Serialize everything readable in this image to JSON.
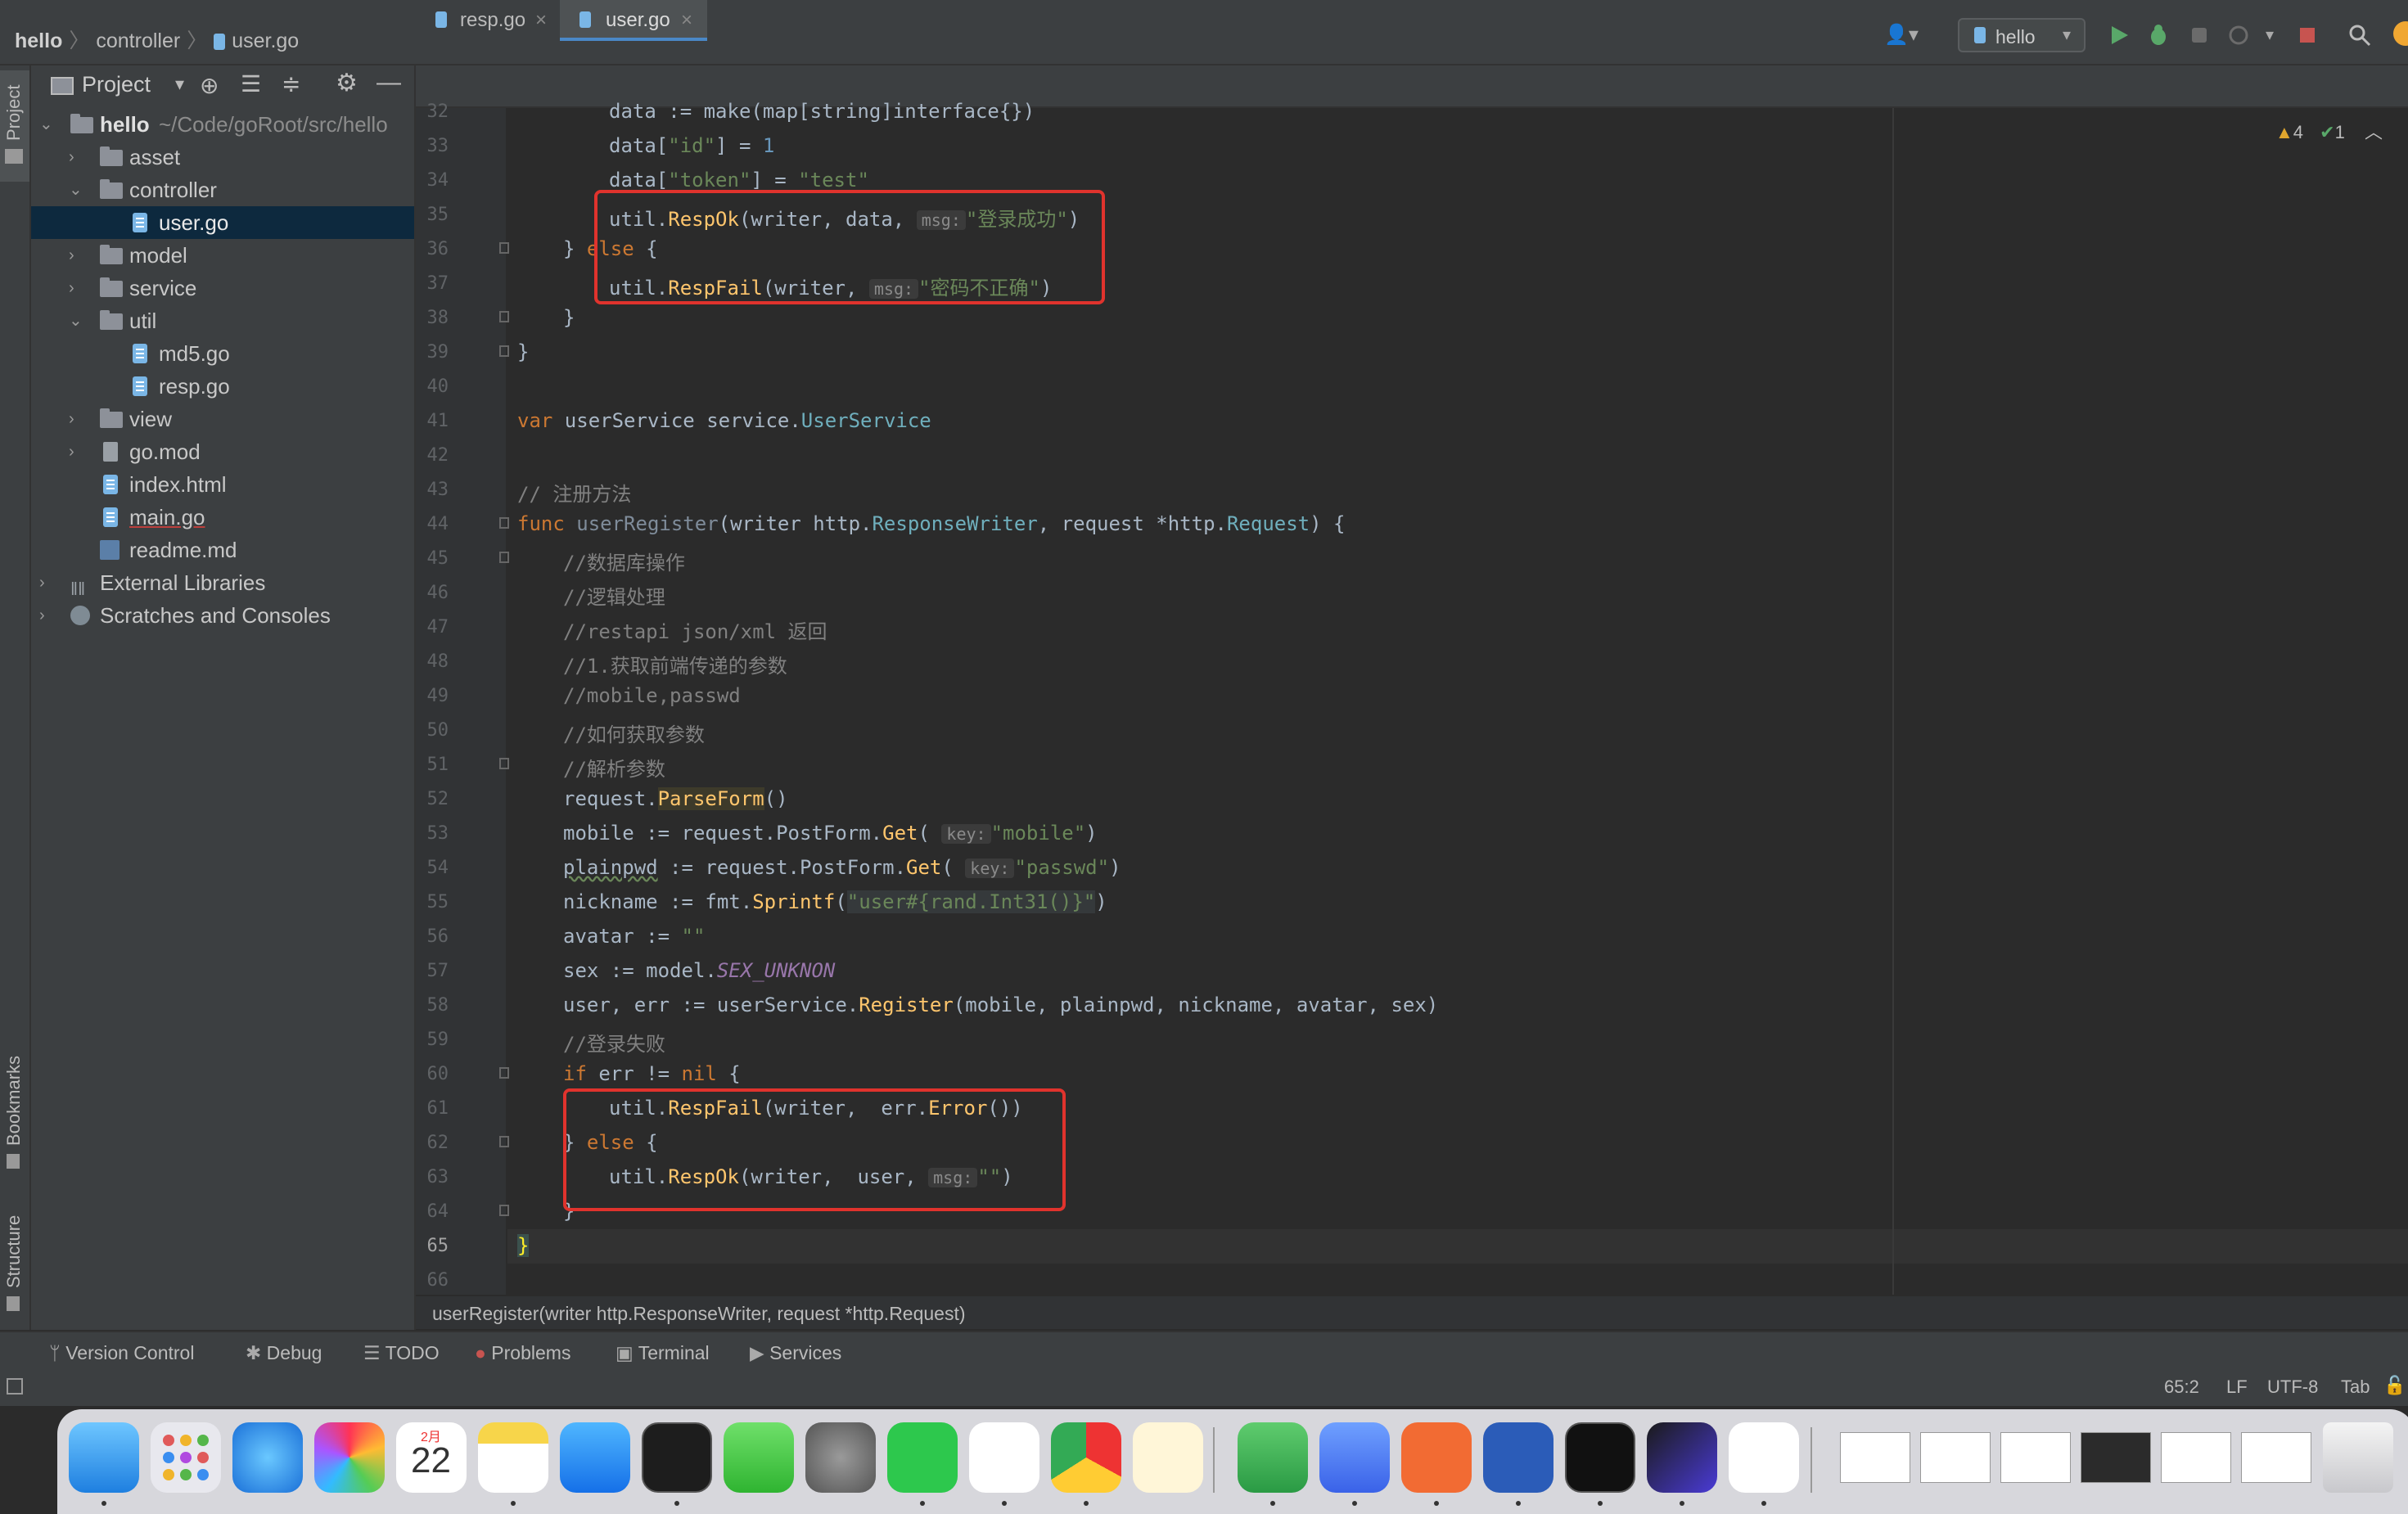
{
  "breadcrumb": {
    "project": "hello",
    "folder": "controller",
    "file": "user.go"
  },
  "toolbar": {
    "run_config": "hello"
  },
  "left_strip": {
    "project": "Project",
    "bookmarks": "Bookmarks",
    "structure": "Structure"
  },
  "project_panel": {
    "title": "Project",
    "root_name": "hello",
    "root_path": "~/Code/goRoot/src/hello",
    "items": {
      "asset": "asset",
      "controller": "controller",
      "user_go": "user.go",
      "model": "model",
      "service": "service",
      "util": "util",
      "md5_go": "md5.go",
      "resp_go": "resp.go",
      "view": "view",
      "go_mod": "go.mod",
      "index_html": "index.html",
      "main_go": "main.go",
      "readme_md": "readme.md",
      "external_libraries": "External Libraries",
      "scratches": "Scratches and Consoles"
    }
  },
  "tabs": {
    "tab1": "resp.go",
    "tab2": "user.go"
  },
  "inspections": {
    "warnings": "4",
    "ok": "1"
  },
  "line_numbers": [
    "32",
    "33",
    "34",
    "35",
    "36",
    "37",
    "38",
    "39",
    "40",
    "41",
    "42",
    "43",
    "44",
    "45",
    "46",
    "47",
    "48",
    "49",
    "50",
    "51",
    "52",
    "53",
    "54",
    "55",
    "56",
    "57",
    "58",
    "59",
    "60",
    "61",
    "62",
    "63",
    "64",
    "65",
    "66"
  ],
  "code": {
    "l32a": "data := make(map[string]interface{})",
    "l33a": "data[",
    "l33b": "\"id\"",
    "l33c": "] = ",
    "l33d": "1",
    "l34a": "data[",
    "l34b": "\"token\"",
    "l34c": "] = ",
    "l34d": "\"test\"",
    "l35a": "util.",
    "l35b": "RespOk",
    "l35c": "(writer, data, ",
    "l35h": "msg:",
    "l35d": "\"登录成功\"",
    "l35e": ")",
    "l36a": "} ",
    "l36b": "else",
    "l36c": " {",
    "l37a": "util.",
    "l37b": "RespFail",
    "l37c": "(writer, ",
    "l37h": "msg:",
    "l37d": "\"密码不正确\"",
    "l37e": ")",
    "l38": "}",
    "l39": "}",
    "l41a": "var",
    "l41b": " userService service.",
    "l41c": "UserService",
    "l43": "// 注册方法",
    "l44a": "func",
    "l44b": " userRegister",
    "l44c": "(writer http.",
    "l44d": "ResponseWriter",
    "l44e": ", request *http.",
    "l44f": "Request",
    "l44g": ") {",
    "l45": "//数据库操作",
    "l46": "//逻辑处理",
    "l47": "//restapi json/xml 返回",
    "l48": "//1.获取前端传递的参数",
    "l49": "//mobile,passwd",
    "l50": "//如何获取参数",
    "l51": "//解析参数",
    "l52a": "request.",
    "l52b": "ParseForm",
    "l52c": "()",
    "l53a": "mobile := request.PostForm.",
    "l53b": "Get",
    "l53c": "( ",
    "l53h": "key:",
    "l53d": "\"mobile\"",
    "l53e": ")",
    "l54a": "plainpwd",
    "l54b": " := request.PostForm.",
    "l54c": "Get",
    "l54d": "( ",
    "l54h": "key:",
    "l54e": "\"passwd\"",
    "l54f": ")",
    "l55a": "nickname := fmt.",
    "l55b": "Sprintf",
    "l55c": "(",
    "l55d": "\"user#{rand.Int31()}\"",
    "l55e": ")",
    "l56a": "avatar := ",
    "l56b": "\"\"",
    "l57a": "sex := model.",
    "l57b": "SEX_UNKNON",
    "l58a": "user, err := userService.",
    "l58b": "Register",
    "l58c": "(mobile, plainpwd, nickname, avatar, sex)",
    "l59": "//登录失败",
    "l60a": "if",
    "l60b": " err != ",
    "l60c": "nil",
    "l60d": " {",
    "l61a": "util.",
    "l61b": "RespFail",
    "l61c": "(writer,  err.",
    "l61d": "Error",
    "l61e": "())",
    "l62a": "} ",
    "l62b": "else",
    "l62c": " {",
    "l63a": "util.",
    "l63b": "RespOk",
    "l63c": "(writer,  user, ",
    "l63h": "msg:",
    "l63d": "\"\"",
    "l63e": ")",
    "l64": "}",
    "l65": "}"
  },
  "editor_breadcrumb": "userRegister(writer http.ResponseWriter, request *http.Request)",
  "tool_windows": {
    "vc": "Version Control",
    "debug": "Debug",
    "todo": "TODO",
    "problems": "Problems",
    "terminal": "Terminal",
    "services": "Services"
  },
  "status": {
    "position": "65:2",
    "line_sep": "LF",
    "encoding": "UTF-8",
    "indent": "Tab"
  },
  "dock": {
    "calendar_month": "2月",
    "calendar_day": "22"
  },
  "colors": {
    "accent": "#4a88c7",
    "highlight_box": "#e0332d",
    "keyword": "#cc7832",
    "string": "#6a8759"
  }
}
